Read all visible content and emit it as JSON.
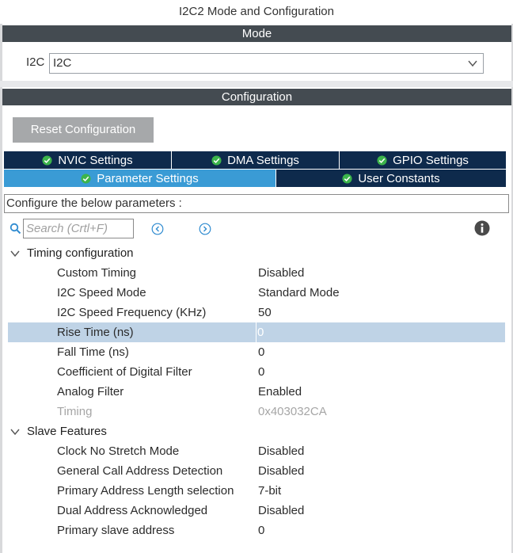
{
  "window": {
    "title": "I2C2 Mode and Configuration"
  },
  "mode": {
    "header": "Mode",
    "i2c_label": "I2C",
    "i2c_value": "I2C"
  },
  "configuration": {
    "header": "Configuration",
    "reset_button": "Reset Configuration",
    "tabs_row1": [
      {
        "label": "NVIC Settings",
        "icon": "check-circle-icon"
      },
      {
        "label": "DMA Settings",
        "icon": "check-circle-icon"
      },
      {
        "label": "GPIO Settings",
        "icon": "check-circle-icon"
      }
    ],
    "tabs_row2": [
      {
        "label": "Parameter Settings",
        "icon": "check-circle-icon",
        "active": true
      },
      {
        "label": "User Constants",
        "icon": "check-circle-icon"
      }
    ],
    "description": "Configure the below parameters :",
    "search_placeholder": "Search (Crtl+F)"
  },
  "groups": [
    {
      "label": "Timing configuration",
      "rows": [
        {
          "name": "Custom Timing",
          "value": "Disabled"
        },
        {
          "name": "I2C Speed Mode",
          "value": "Standard Mode"
        },
        {
          "name": "I2C Speed Frequency (KHz)",
          "value": "50"
        },
        {
          "name": "Rise Time (ns)",
          "value": "0",
          "selected": true
        },
        {
          "name": "Fall Time (ns)",
          "value": "0"
        },
        {
          "name": "Coefficient of Digital Filter",
          "value": "0"
        },
        {
          "name": "Analog Filter",
          "value": "Enabled"
        },
        {
          "name": "Timing",
          "value": "0x403032CA",
          "disabled": true
        }
      ]
    },
    {
      "label": "Slave Features",
      "rows": [
        {
          "name": "Clock No Stretch Mode",
          "value": "Disabled"
        },
        {
          "name": "General Call Address Detection",
          "value": "Disabled"
        },
        {
          "name": "Primary Address Length selection",
          "value": "7-bit"
        },
        {
          "name": "Dual Address Acknowledged",
          "value": "Disabled"
        },
        {
          "name": "Primary slave address",
          "value": "0"
        }
      ]
    }
  ],
  "colors": {
    "section_header": "#444b51",
    "tab_dark": "#0e2a4c",
    "tab_active": "#3a9bd5",
    "selected_row": "#bfd3e6",
    "check_green": "#3cb44b"
  }
}
